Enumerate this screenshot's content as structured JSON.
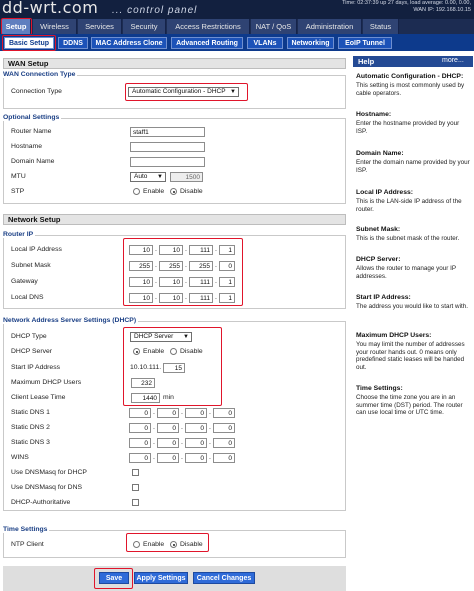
{
  "header": {
    "logo": "dd-wrt.com",
    "subtitle": "... control panel",
    "info_line1": "Time: 02:37:39 up 27 days, load average: 0.00, 0.00,",
    "info_line2": "WAN IP: 192.168.10.15"
  },
  "main_tabs": [
    "Setup",
    "Wireless",
    "Services",
    "Security",
    "Access Restrictions",
    "NAT / QoS",
    "Administration",
    "Status"
  ],
  "sub_tabs": [
    "Basic Setup",
    "DDNS",
    "MAC Address Clone",
    "Advanced Routing",
    "VLANs",
    "Networking",
    "EoIP Tunnel"
  ],
  "wan": {
    "section_title": "WAN Setup",
    "legend": "WAN Connection Type",
    "connection_type_label": "Connection Type",
    "connection_type_value": "Automatic Configuration - DHCP"
  },
  "optional": {
    "legend": "Optional Settings",
    "router_name_label": "Router Name",
    "router_name_value": "staff1",
    "hostname_label": "Hostname",
    "domain_name_label": "Domain Name",
    "mtu_label": "MTU",
    "mtu_mode": "Auto",
    "mtu_value": "1500",
    "stp_label": "STP",
    "enable": "Enable",
    "disable": "Disable"
  },
  "network": {
    "section_title": "Network Setup",
    "router_ip_legend": "Router IP",
    "local_ip_label": "Local IP Address",
    "local_ip": [
      "10",
      "10",
      "111",
      "1"
    ],
    "subnet_label": "Subnet Mask",
    "subnet": [
      "255",
      "255",
      "255",
      "0"
    ],
    "gateway_label": "Gateway",
    "gateway": [
      "10",
      "10",
      "111",
      "1"
    ],
    "local_dns_label": "Local DNS",
    "local_dns": [
      "10",
      "10",
      "111",
      "1"
    ]
  },
  "dhcp": {
    "legend": "Network Address Server Settings (DHCP)",
    "type_label": "DHCP Type",
    "type_value": "DHCP Server",
    "server_label": "DHCP Server",
    "enable": "Enable",
    "disable": "Disable",
    "start_ip_label": "Start IP Address",
    "start_ip_prefix": "10.10.111.",
    "start_ip_last": "15",
    "max_users_label": "Maximum DHCP Users",
    "max_users": "232",
    "lease_label": "Client Lease Time",
    "lease_value": "1440",
    "lease_unit": "min",
    "static_dns1_label": "Static DNS 1",
    "static_dns2_label": "Static DNS 2",
    "static_dns3_label": "Static DNS 3",
    "static_dns_octets": [
      "0",
      "0",
      "0",
      "0"
    ],
    "wins_label": "WINS",
    "dnsmasq_dhcp_label": "Use DNSMasq for DHCP",
    "dnsmasq_dns_label": "Use DNSMasq for DNS",
    "authoritative_label": "DHCP-Authoritative"
  },
  "time": {
    "legend": "Time Settings",
    "ntp_label": "NTP Client",
    "enable": "Enable",
    "disable": "Disable"
  },
  "buttons": {
    "save": "Save",
    "apply": "Apply Settings",
    "cancel": "Cancel Changes"
  },
  "help": {
    "title": "Help",
    "more": "more...",
    "h1": "Automatic Configuration - DHCP:",
    "p1": "This setting is most commonly used by cable operators.",
    "h2": "Hostname:",
    "p2": "Enter the hostname provided by your ISP.",
    "h3": "Domain Name:",
    "p3": "Enter the domain name provided by your ISP.",
    "h4": "Local IP Address:",
    "p4": "This is the LAN-side IP address of the router.",
    "h5": "Subnet Mask:",
    "p5": "This is the subnet mask of the router.",
    "h6": "DHCP Server:",
    "p6": "Allows the router to manage your IP addresses.",
    "h7": "Start IP Address:",
    "p7": "The address you would like to start with.",
    "h8": "Maximum DHCP Users:",
    "p8": "You may limit the number of addresses your router hands out. 0 means only predefined static leases will be handed out.",
    "h9": "Time Settings:",
    "p9": "Choose the time zone you are in an summer time (DST) period. The router can use local time or UTC time."
  },
  "colors": {
    "header_bg": "#12203f",
    "subtab_bg": "#0d3a8c",
    "button_blue": "#2f6bd8",
    "highlight_red": "#e0152b",
    "help_bar": "#244a94"
  }
}
